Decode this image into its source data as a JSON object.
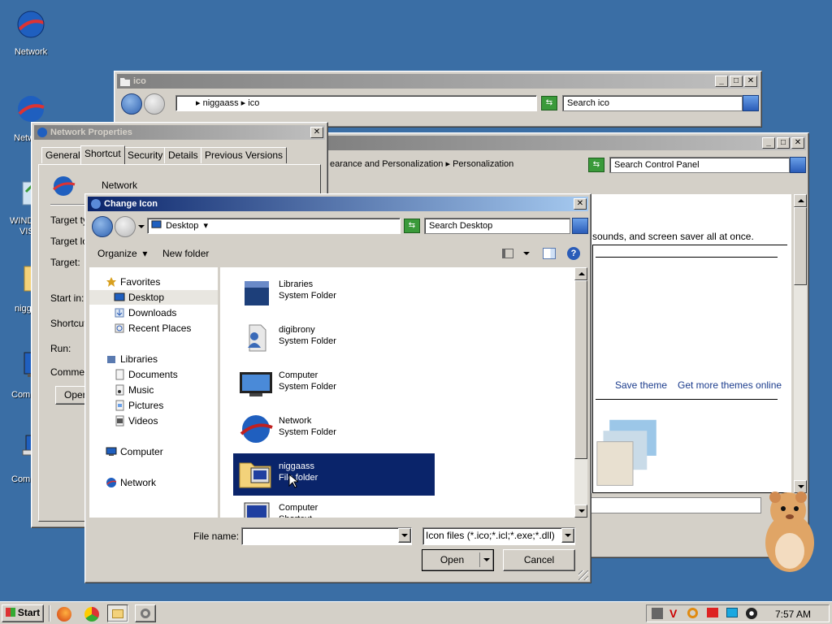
{
  "desktop": {
    "icons": [
      {
        "label": "Network",
        "icon": "network-globe-icon"
      },
      {
        "label": "Netw",
        "icon": "network-globe-icon"
      },
      {
        "label": "WIND",
        "icon": "recycle-bin-icon"
      },
      {
        "label": "VIS",
        "icon": "recycle-bin-icon"
      },
      {
        "label": "nigg",
        "icon": "folder-icon"
      },
      {
        "label": "Comp",
        "icon": "computer-icon"
      },
      {
        "label": "Comp",
        "icon": "laptop-icon"
      }
    ]
  },
  "ico_window": {
    "title": "ico",
    "breadcrumb": [
      "niggaass",
      "ico"
    ],
    "search_placeholder": "Search ico"
  },
  "control_panel_window": {
    "breadcrumb": [
      "earance and Personalization",
      "Personalization"
    ],
    "search_placeholder": "Search Control Panel",
    "description": "sounds, and screen saver all at once.",
    "save_theme": "Save theme",
    "more_themes": "Get more themes online"
  },
  "network_properties": {
    "title": "Network Properties",
    "tabs": [
      "General",
      "Shortcut",
      "Security",
      "Details",
      "Previous Versions"
    ],
    "selected_tab": "Shortcut",
    "name": "Network",
    "labels": [
      "Target ty",
      "Target lo",
      "Target:",
      "Start in:",
      "Shortcut",
      "Run:",
      "Commer"
    ],
    "open_button": "Oper"
  },
  "change_icon": {
    "title": "Change Icon",
    "location": "Desktop",
    "search_placeholder": "Search Desktop",
    "toolbar": {
      "organize": "Organize",
      "new_folder": "New folder"
    },
    "nav_tree": [
      {
        "label": "Favorites",
        "icon": "star-icon",
        "level": 0
      },
      {
        "label": "Desktop",
        "icon": "desktop-icon",
        "level": 1,
        "selected": true
      },
      {
        "label": "Downloads",
        "icon": "downloads-icon",
        "level": 1
      },
      {
        "label": "Recent Places",
        "icon": "recent-places-icon",
        "level": 1
      },
      {
        "label": "Libraries",
        "icon": "libraries-icon",
        "level": 0
      },
      {
        "label": "Documents",
        "icon": "documents-icon",
        "level": 1
      },
      {
        "label": "Music",
        "icon": "music-icon",
        "level": 1
      },
      {
        "label": "Pictures",
        "icon": "pictures-icon",
        "level": 1
      },
      {
        "label": "Videos",
        "icon": "videos-icon",
        "level": 1
      },
      {
        "label": "Computer",
        "icon": "computer-icon",
        "level": 0
      },
      {
        "label": "Network",
        "icon": "network-icon",
        "level": 0
      }
    ],
    "files": [
      {
        "name": "Libraries",
        "type": "System Folder",
        "icon": "libraries-icon"
      },
      {
        "name": "digibrony",
        "type": "System Folder",
        "icon": "user-folder-icon"
      },
      {
        "name": "Computer",
        "type": "System Folder",
        "icon": "computer-icon"
      },
      {
        "name": "Network",
        "type": "System Folder",
        "icon": "network-globe-icon"
      },
      {
        "name": "niggaass",
        "type": "File folder",
        "icon": "folder-icon",
        "selected": true
      },
      {
        "name": "Computer",
        "type": "Shortcut",
        "icon": "computer-icon"
      }
    ],
    "file_name_label": "File name:",
    "file_name_value": "",
    "filter": "Icon files (*.ico;*.icl;*.exe;*.dll)",
    "open_button": "Open",
    "cancel_button": "Cancel"
  },
  "taskbar": {
    "start_label": "Start",
    "clock": "7:57 AM",
    "tray_icons": [
      "tool-icon",
      "antivirus-icon",
      "search-tray-icon",
      "flag-icon",
      "display-icon",
      "volume-icon"
    ]
  }
}
